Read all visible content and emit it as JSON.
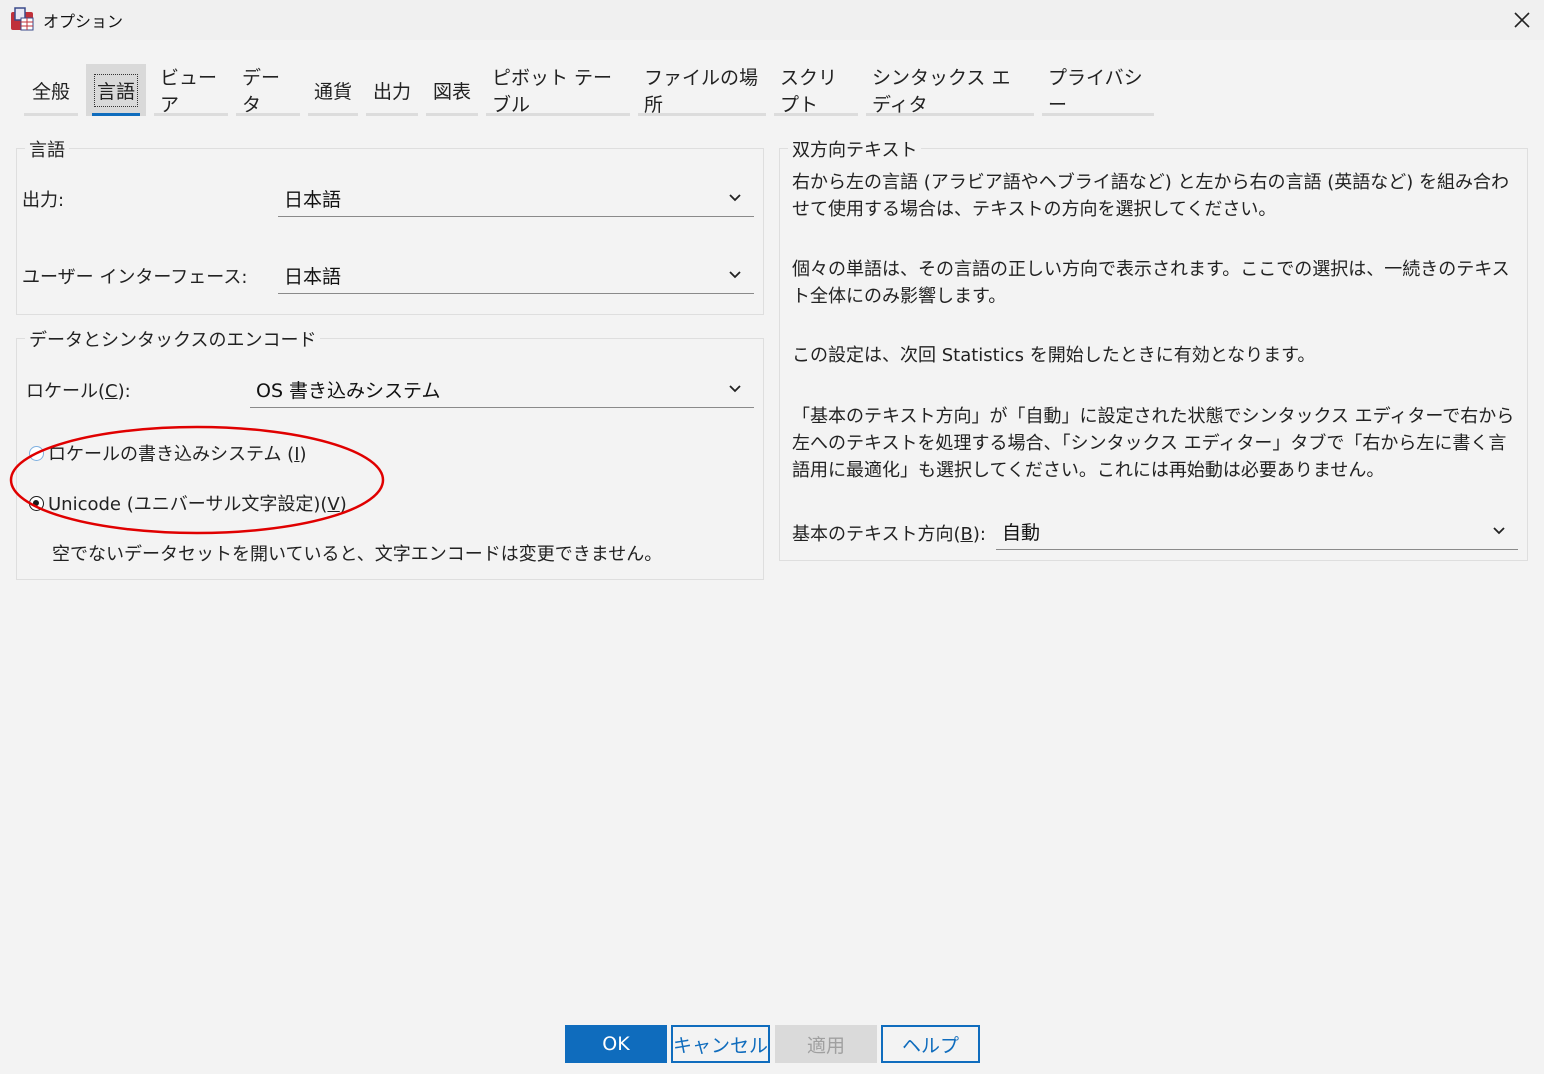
{
  "window": {
    "title": "オプション",
    "close_icon": "close-icon"
  },
  "tabs": [
    {
      "label": "全般"
    },
    {
      "label": "言語",
      "active": true
    },
    {
      "label": "ビューア"
    },
    {
      "label": "データ"
    },
    {
      "label": "通貨"
    },
    {
      "label": "出力"
    },
    {
      "label": "図表"
    },
    {
      "label": "ピボット テーブル"
    },
    {
      "label": "ファイルの場所"
    },
    {
      "label": "スクリプト"
    },
    {
      "label": "シンタックス エディタ"
    },
    {
      "label": "プライバシー"
    }
  ],
  "language_group": {
    "legend": "言語",
    "output_label": "出力:",
    "output_value": "日本語",
    "ui_label": "ユーザー インターフェース:",
    "ui_value": "日本語"
  },
  "encoding_group": {
    "legend": "データとシンタックスのエンコード",
    "locale_label": "ロケール(",
    "locale_mnemonic": "C",
    "locale_label_end": "):",
    "locale_value": "OS 書き込みシステム",
    "radio_locale_label": "ロケールの書き込みシステム (",
    "radio_locale_mnemonic": "I",
    "radio_locale_end": ")",
    "radio_unicode_label": "Unicode (ユニバーサル文字設定)(",
    "radio_unicode_mnemonic": "V",
    "radio_unicode_end": ")",
    "selected": "unicode",
    "note": "空でないデータセットを開いていると、文字エンコードは変更できません。"
  },
  "bidi_group": {
    "legend": "双方向テキスト",
    "para1": "右から左の言語 (アラビア語やヘブライ語など) と左から右の言語 (英語など) を組み合わせて使用する場合は、テキストの方向を選択してください。",
    "para2": "個々の単語は、その言語の正しい方向で表示されます。ここでの選択は、一続きのテキスト全体にのみ影響します。",
    "para3": "この設定は、次回 Statistics を開始したときに有効となります。",
    "para4": "「基本のテキスト方向」が「自動」に設定された状態でシンタックス エディターで右から左へのテキストを処理する場合、「シンタックス エディター」タブで「右から左に書く言語用に最適化」も選択してください。これには再始動は必要ありません。",
    "direction_label": "基本のテキスト方向(",
    "direction_mnemonic": "B",
    "direction_label_end": "):",
    "direction_value": "自動"
  },
  "buttons": {
    "ok": "OK",
    "cancel": "キャンセル",
    "apply": "適用",
    "help": "ヘルプ"
  },
  "annotation": {
    "color": "#e00000"
  }
}
